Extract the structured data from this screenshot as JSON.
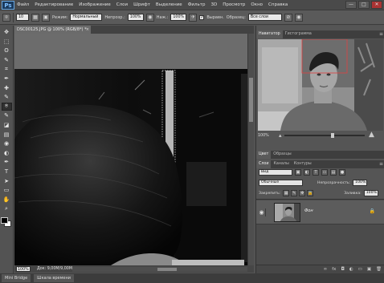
{
  "app": {
    "logo": "Ps",
    "menu": [
      "Файл",
      "Редактирование",
      "Изображение",
      "Слои",
      "Шрифт",
      "Выделение",
      "Фильтр",
      "3D",
      "Просмотр",
      "Окно",
      "Справка"
    ],
    "window_controls": [
      "—",
      "□",
      "✕"
    ]
  },
  "options_bar": {
    "brush_size": "10",
    "mode_label": "Режим:",
    "mode_value": "Нормальный",
    "opacity_label": "Непрозр.:",
    "opacity_value": "100%",
    "pressure_label": "Наж.:",
    "pressure_value": "100%",
    "align_label": "Выравн.",
    "sample_label": "Образец:",
    "sample_value": "Все слои"
  },
  "toolbar": {
    "tools": [
      "move-icon",
      "marquee-icon",
      "lasso-icon",
      "quick-select-icon",
      "crop-icon",
      "eyedropper-icon",
      "healing-icon",
      "brush-icon",
      "clone-stamp-icon",
      "history-brush-icon",
      "eraser-icon",
      "gradient-icon",
      "blur-icon",
      "dodge-icon",
      "pen-icon",
      "type-icon",
      "path-select-icon",
      "shape-icon",
      "hand-icon",
      "zoom-icon"
    ],
    "glyphs": [
      "✥",
      "⬚",
      "ʘ",
      "✎",
      "⌗",
      "✒",
      "✚",
      "✎",
      "⍟",
      "✎",
      "◪",
      "▤",
      "◉",
      "◐",
      "✒",
      "T",
      "➤",
      "▭",
      "✋",
      "🔍"
    ],
    "active_index": 8,
    "foreground_color": "#000000",
    "background_color": "#ffffff"
  },
  "document": {
    "tab_title": "DSC00125.JPG @ 100% (RGB/8*) *",
    "zoom": "100%",
    "info": "Док: 9,00M/9,00M"
  },
  "bottom_tabs": [
    "Mini Bridge",
    "Шкала времени"
  ],
  "panels": {
    "navigator_tabs": [
      "Навигатор",
      "Гистограмма"
    ],
    "navigator_zoom": "100%",
    "color_tabs": [
      "Цвет",
      "Образцы"
    ],
    "layer_tabs": [
      "Слои",
      "Каналы",
      "Контуры"
    ],
    "layer_filter": "Вид",
    "blend_mode": "Обычные",
    "opacity_label": "Непрозрачность:",
    "opacity_value": "100%",
    "lock_label": "Закрепить:",
    "fill_label": "Заливка:",
    "fill_value": "100%",
    "layer_name": "Фон",
    "menu_glyph": "≡"
  }
}
